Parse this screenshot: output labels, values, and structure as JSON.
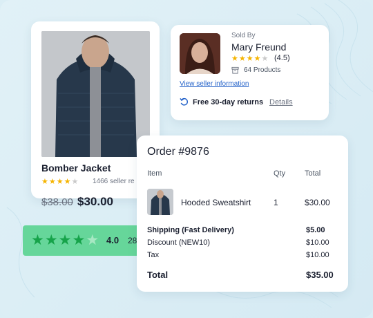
{
  "product": {
    "name": "Bomber Jacket",
    "rating_stars": 4.5,
    "reviews": "1466 seller re",
    "old_price": "$38.00",
    "new_price": "$30.00"
  },
  "seller": {
    "sold_by_label": "Sold By",
    "name": "Mary Freund",
    "rating": "(4.5)",
    "products": "64 Products",
    "info_link": "View seller information",
    "returns_text": "Free 30-day returns",
    "details_link": "Details"
  },
  "rating_strip": {
    "stars": 4,
    "score": "4.0",
    "count": "28"
  },
  "order": {
    "title": "Order #9876",
    "headers": {
      "item": "Item",
      "qty": "Qty",
      "total": "Total"
    },
    "line": {
      "name": "Hooded Sweatshirt",
      "qty": "1",
      "total": "$30.00"
    },
    "summary": [
      {
        "label": "Shipping (Fast Delivery)",
        "value": "$5.00",
        "bold": true
      },
      {
        "label": "Discount (NEW10)",
        "value": "$10.00",
        "bold": false
      },
      {
        "label": "Tax",
        "value": "$10.00",
        "bold": false
      }
    ],
    "total_label": "Total",
    "total_value": "$35.00"
  },
  "colors": {
    "background": "#dbeef5",
    "star_yellow": "#f5b400",
    "link_blue": "#2563c9",
    "strip_green": "#66d69a",
    "star_green": "#16a34a"
  },
  "icons": [
    "star-icon",
    "box-icon",
    "refresh-icon"
  ]
}
